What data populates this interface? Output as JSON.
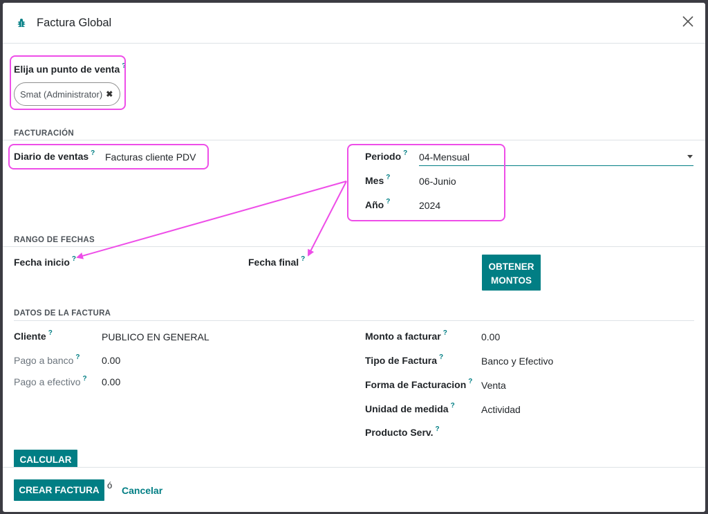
{
  "dialog": {
    "title": "Factura Global",
    "title_icon": "bug-icon",
    "close_icon": "close-icon"
  },
  "help_marker": "?",
  "pos": {
    "label": "Elija un punto de venta",
    "tag": "Smat (Administrator)",
    "tag_remove": "✖"
  },
  "facturacion": {
    "section": "FACTURACIÓN",
    "diario_label": "Diario de ventas",
    "diario_value": "Facturas cliente PDV",
    "periodo_label": "Periodo",
    "periodo_value": "04-Mensual",
    "mes_label": "Mes",
    "mes_value": "06-Junio",
    "anio_label": "Año",
    "anio_value": "2024"
  },
  "rango": {
    "section": "RANGO DE FECHAS",
    "inicio_label": "Fecha inicio",
    "final_label": "Fecha final",
    "obtener_button": "OBTENER MONTOS"
  },
  "datos": {
    "section": "DATOS DE LA FACTURA",
    "cliente_label": "Cliente",
    "cliente_value": "PUBLICO EN GENERAL",
    "pago_banco_label": "Pago a banco",
    "pago_banco_value": "0.00",
    "pago_efectivo_label": "Pago a efectivo",
    "pago_efectivo_value": "0.00",
    "monto_label": "Monto a facturar",
    "monto_value": "0.00",
    "tipo_label": "Tipo de Factura",
    "tipo_value": "Banco y Efectivo",
    "forma_label": "Forma de Facturacion",
    "forma_value": "Venta",
    "unidad_label": "Unidad de medida",
    "unidad_value": "Actividad",
    "producto_label": "Producto Serv.",
    "calcular_button": "CALCULAR"
  },
  "footer": {
    "crear_button": "CREAR FACTURA",
    "separator": "ó",
    "cancel_link": "Cancelar"
  },
  "colors": {
    "accent": "#017e84",
    "highlight": "#ee4de8"
  }
}
